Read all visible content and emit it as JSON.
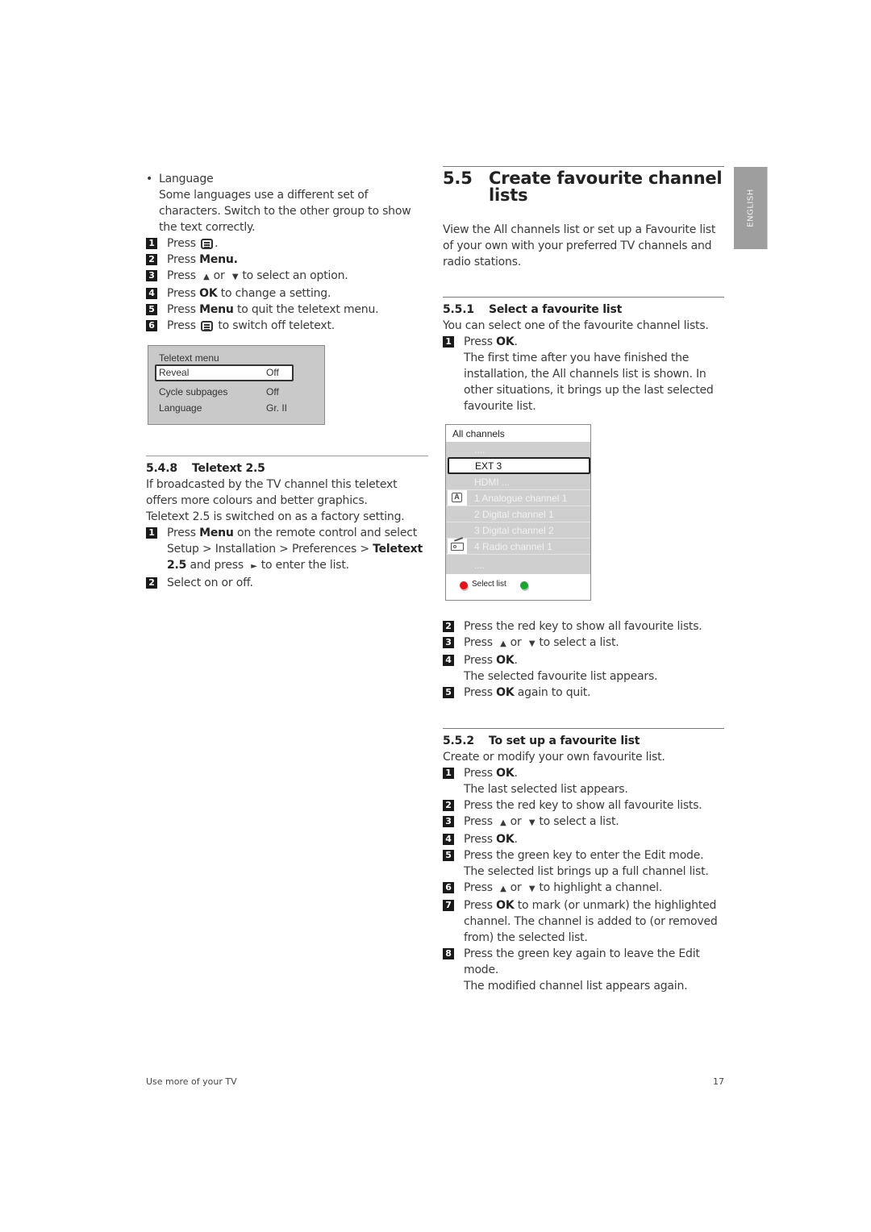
{
  "left_column": {
    "language_bullet": {
      "title": "Language",
      "text": "Some languages use a different set of characters. Switch to the other group to show the text correctly."
    },
    "steps": [
      {
        "num": "1",
        "pre": "Press",
        "icon": "teletext-icon",
        "post": "."
      },
      {
        "num": "2",
        "pre": "Press",
        "bold": "Menu.",
        "post": ""
      },
      {
        "num": "3",
        "pre": "Press",
        "up": "▲",
        "or": "or",
        "down": "▼",
        "post": "to select an option."
      },
      {
        "num": "4",
        "pre": "Press",
        "bold": "OK",
        "post": "to change a setting."
      },
      {
        "num": "5",
        "pre": "Press",
        "bold": "Menu",
        "post": "to quit the teletext menu."
      },
      {
        "num": "6",
        "pre": "Press",
        "icon": "teletext-icon",
        "post": "to switch off teletext."
      }
    ],
    "teletext_menu": {
      "title": "Teletext menu",
      "rows": [
        {
          "label": "Reveal",
          "value": "Off",
          "selected": true
        },
        {
          "label": "Cycle subpages",
          "value": "Off",
          "selected": false
        },
        {
          "label": "Language",
          "value": "Gr. II",
          "selected": false
        }
      ]
    },
    "section_548": {
      "number": "5.4.8",
      "title": "Teletext 2.5",
      "para1": "If broadcasted by the TV channel this teletext offers more colours and better graphics.",
      "para2": "Teletext 2.5 is switched on as a factory setting.",
      "step1": {
        "num": "1",
        "pre": "Press",
        "bold1": "Menu",
        "mid": "on the remote control and select Setup > Installation > Preferences >",
        "bold2": "Teletext 2.5",
        "mid2": "and press",
        "arrow": "►",
        "post": "to enter the list."
      },
      "step2": {
        "num": "2",
        "text": "Select on or off."
      }
    }
  },
  "right_column": {
    "section_55": {
      "number": "5.5",
      "title": "Create favourite channel lists",
      "intro": "View the All channels list or set up a Favourite list of your own with your preferred TV channels and radio stations."
    },
    "section_551": {
      "number": "5.5.1",
      "title": "Select a favourite list",
      "intro": "You can select one of the favourite channel lists.",
      "step1": {
        "num": "1",
        "pre": "Press",
        "bold": "OK",
        "post": "."
      },
      "step1_note": "The first time after you have finished the installation, the All channels list is shown. In other situations, it brings up the last selected favourite list.",
      "steps_after": [
        {
          "num": "2",
          "text": "Press the red key to show all favourite lists."
        },
        {
          "num": "3",
          "pre": "Press",
          "up": "▲",
          "or": "or",
          "down": "▼",
          "post": "to select a list."
        },
        {
          "num": "4",
          "pre": "Press",
          "bold": "OK",
          "post": ".",
          "note": "The selected favourite list appears."
        },
        {
          "num": "5",
          "pre": "Press",
          "bold": "OK",
          "post": "again to quit."
        }
      ]
    },
    "channel_list": {
      "title": "All channels",
      "items": [
        {
          "label": "....",
          "icon": "",
          "selected": false
        },
        {
          "label": "EXT 3",
          "icon": "",
          "selected": true
        },
        {
          "label": "HDMI ...",
          "icon": "",
          "selected": false
        },
        {
          "label": "1 Analogue channel 1",
          "icon": "analogue-icon",
          "selected": false
        },
        {
          "label": "2 Digital channel 1",
          "icon": "",
          "selected": false
        },
        {
          "label": "3 Digital channel 2",
          "icon": "",
          "selected": false
        },
        {
          "label": "4 Radio channel 1",
          "icon": "radio-icon",
          "selected": false
        },
        {
          "label": "....",
          "icon": "",
          "selected": false
        }
      ],
      "footer": {
        "red_label": "Select list",
        "red_color": "#e3121b",
        "green_color": "#1aa531"
      }
    },
    "section_552": {
      "number": "5.5.2",
      "title": "To set up a favourite list",
      "intro": "Create or modify your own favourite list.",
      "steps": [
        {
          "num": "1",
          "pre": "Press",
          "bold": "OK",
          "post": ".",
          "note": "The last selected list appears."
        },
        {
          "num": "2",
          "text": "Press the red key to show all favourite lists."
        },
        {
          "num": "3",
          "pre": "Press",
          "up": "▲",
          "or": "or",
          "down": "▼",
          "post": "to select a list."
        },
        {
          "num": "4",
          "pre": "Press",
          "bold": "OK",
          "post": "."
        },
        {
          "num": "5",
          "text": "Press the green key to enter the Edit mode.",
          "note": "The selected list brings up a full channel list."
        },
        {
          "num": "6",
          "pre": "Press",
          "up": "▲",
          "or": "or",
          "down": "▼",
          "post": "to highlight a channel."
        },
        {
          "num": "7",
          "pre": "Press",
          "bold": "OK",
          "post": "to mark (or unmark) the highlighted channel. The channel is added to (or removed from) the selected list."
        },
        {
          "num": "8",
          "text": "Press the green key again to leave the Edit mode.",
          "note": "The modified channel list appears again."
        }
      ]
    }
  },
  "side_tab": {
    "label": "ENGLISH"
  },
  "footer": {
    "left": "Use more of your TV",
    "page_number": "17"
  }
}
